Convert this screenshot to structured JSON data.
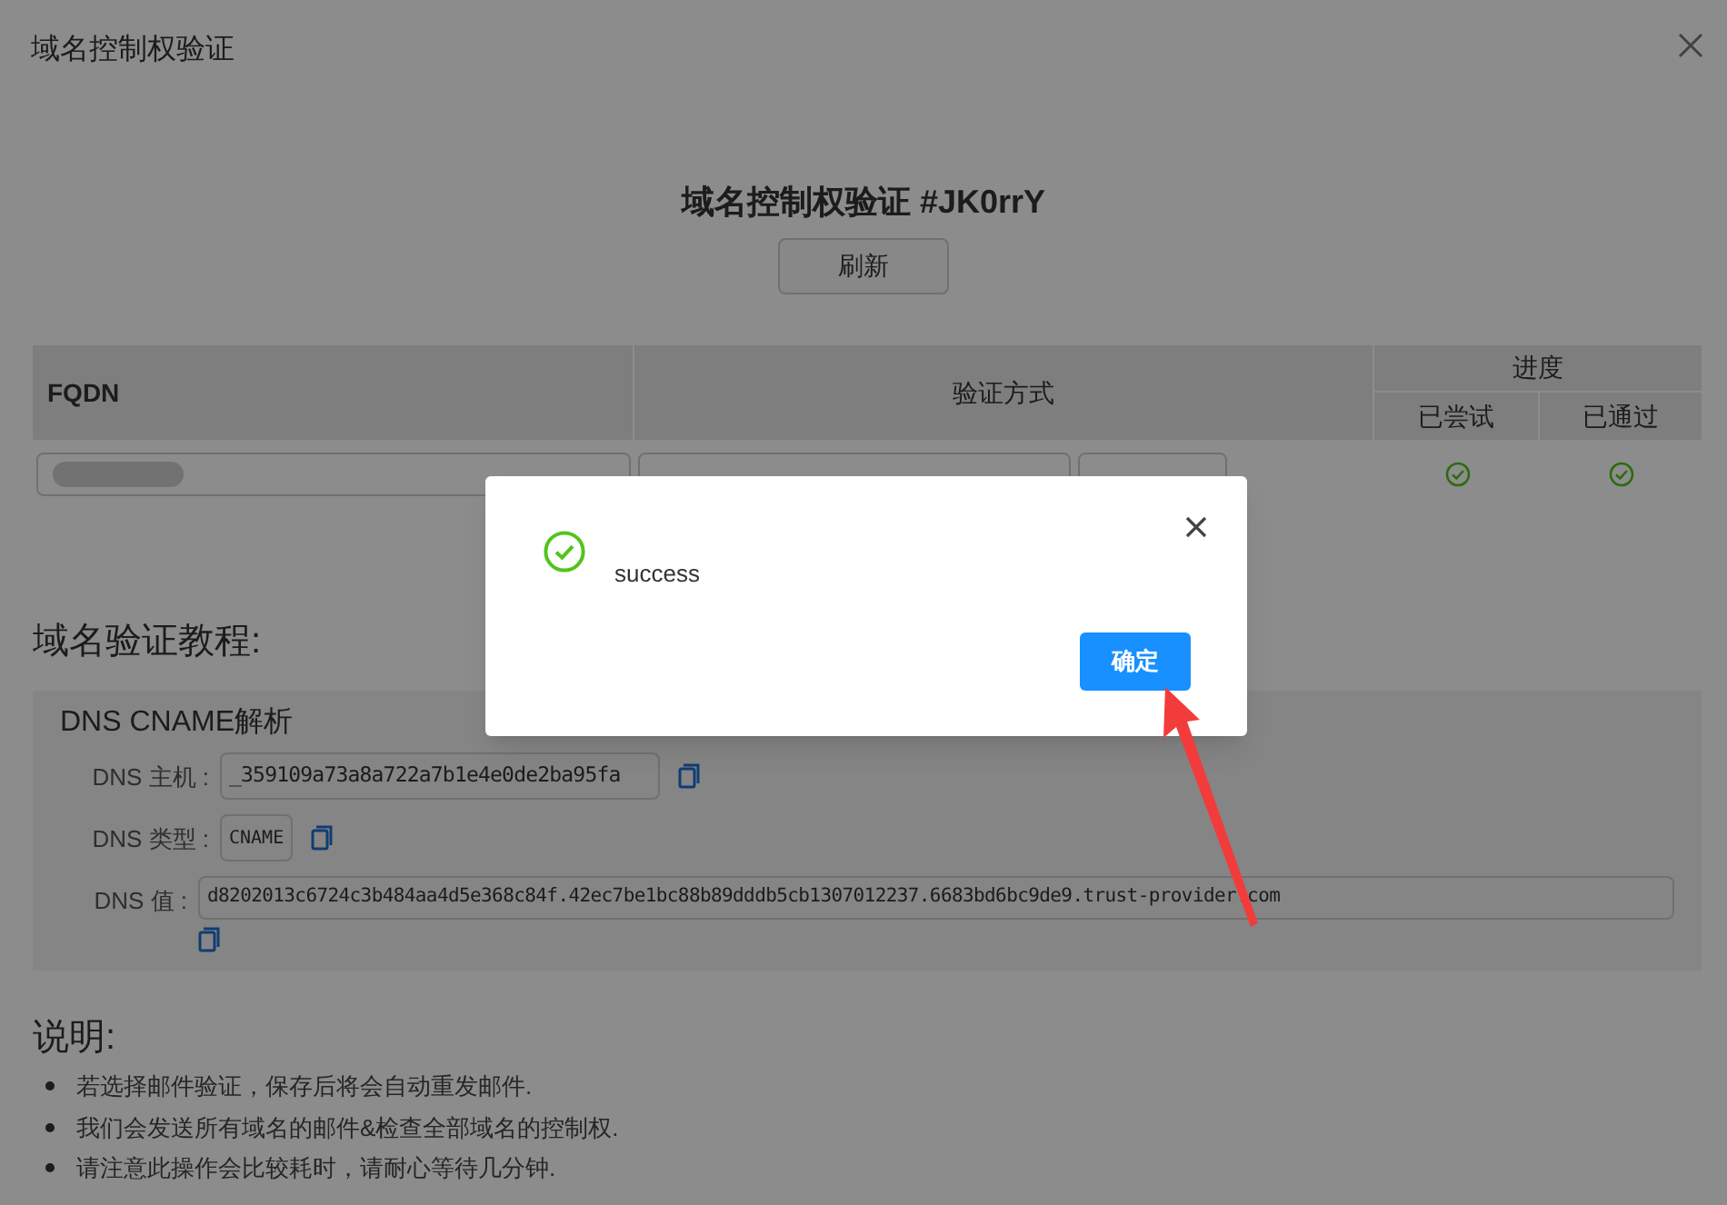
{
  "window": {
    "title": "域名控制权验证"
  },
  "heading": "域名控制权验证 #JK0rrY",
  "refresh_button": "刷新",
  "table": {
    "columns": [
      "FQDN",
      "验证方式"
    ],
    "progress_group": "进度",
    "progress_columns": [
      "已尝试",
      "已通过"
    ],
    "rows": [
      {
        "tried": true,
        "passed": true
      }
    ]
  },
  "tutorial": {
    "title": "域名验证教程:",
    "method": "DNS CNAME解析",
    "fields": [
      {
        "label": "DNS 主机 :",
        "value": "_359109a73a8a722a7b1e4e0de2ba95fa",
        "kind": "short"
      },
      {
        "label": "DNS 类型 :",
        "value": "CNAME",
        "kind": "tiny"
      },
      {
        "label": "DNS 值 :",
        "value": "d8202013c6724c3b484aa4d5e368c84f.42ec7be1bc88b89dddb5cb1307012237.6683bd6bc9de9.trust-provider.com",
        "kind": "wide"
      }
    ]
  },
  "notes": {
    "title": "说明:",
    "items": [
      "若选择邮件验证，保存后将会自动重发邮件.",
      "我们会发送所有域名的邮件&检查全部域名的控制权.",
      "请注意此操作会比较耗时，请耐心等待几分钟."
    ]
  },
  "dialog": {
    "message": "success",
    "confirm": "确定"
  }
}
